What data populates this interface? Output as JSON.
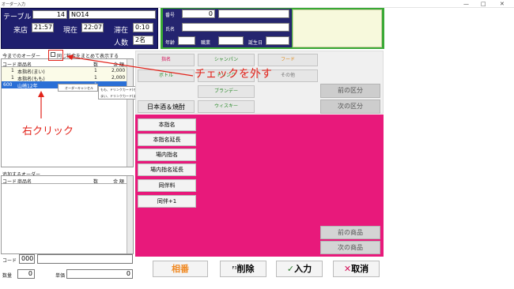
{
  "window": {
    "title": "オーダー入力",
    "minimize": "—",
    "maximize": "□",
    "close": "✕"
  },
  "header": {
    "table_label": "テーブル",
    "table_no": "14",
    "table_name": "NO14",
    "arrive_label": "来店",
    "arrive_time": "21:57",
    "now_label": "現在",
    "now_time": "22:07",
    "stay_label": "滞在",
    "stay_time": "0:10",
    "people_label": "人数",
    "people_value": "2名"
  },
  "customer": {
    "no_label": "番号",
    "no_value": "0",
    "name_label": "氏名",
    "a_label": "年齢",
    "b_label": "職業",
    "c_label": "誕生日"
  },
  "order_list": {
    "title": "今までのオーダー",
    "checkbox_label": "同じ料金をまとめて表示する",
    "columns": [
      "コード",
      "商品名",
      "数",
      "金 額"
    ],
    "rows": [
      {
        "code": "1",
        "name": "本指名(まい)",
        "qty": "1",
        "amount": "2,000"
      },
      {
        "code": "1",
        "name": "本指名(もも)",
        "qty": "1",
        "amount": "2,000"
      },
      {
        "code": "600",
        "name": "山崎12年",
        "qty": "1",
        "amount": ""
      }
    ]
  },
  "context_menu": {
    "item1": "オーダーキャンセル",
    "sub1": "もも、ドリンクカード(もも) ドリンク金額：1500、Other1：0、Other2：0",
    "sub2": "まい、ドリンクカード(まい) ドリンク金額：1500、Other1：0、Other2：0"
  },
  "add_list": {
    "title": "追加するオーダー",
    "columns": [
      "コード",
      "商品名",
      "数",
      "金 額"
    ]
  },
  "input": {
    "code_label": "コード",
    "code_value": "000",
    "qty_label": "数量",
    "qty_value": "0",
    "price_label": "単価",
    "price_value": "0"
  },
  "categories": [
    "指名",
    "ボトル",
    "シャンパン",
    "フード",
    "ドリンク",
    "その他",
    "ブランデー",
    "日本酒＆焼酎",
    "ウィスキー"
  ],
  "nav": {
    "prev_cat": "前の区分",
    "next_cat": "次の区分",
    "prev_item": "前の商品",
    "next_item": "次の商品"
  },
  "items": [
    "本指名",
    "本指名延長",
    "場内指名",
    "場内指名延長",
    "同伴料",
    "同伴+1"
  ],
  "buttons": {
    "aiban": "相番",
    "delete": "削除",
    "delete_prefix": "F3",
    "enter": "入力",
    "cancel": "取消"
  },
  "annotations": {
    "uncheck": "チェックを外す",
    "right_click": "右クリック"
  },
  "colors": {
    "navy": "#1f1f6e",
    "green": "#39a935",
    "magenta": "#e8197b",
    "annotation_red": "#e2231a",
    "aiban_orange": "#f08a24"
  }
}
